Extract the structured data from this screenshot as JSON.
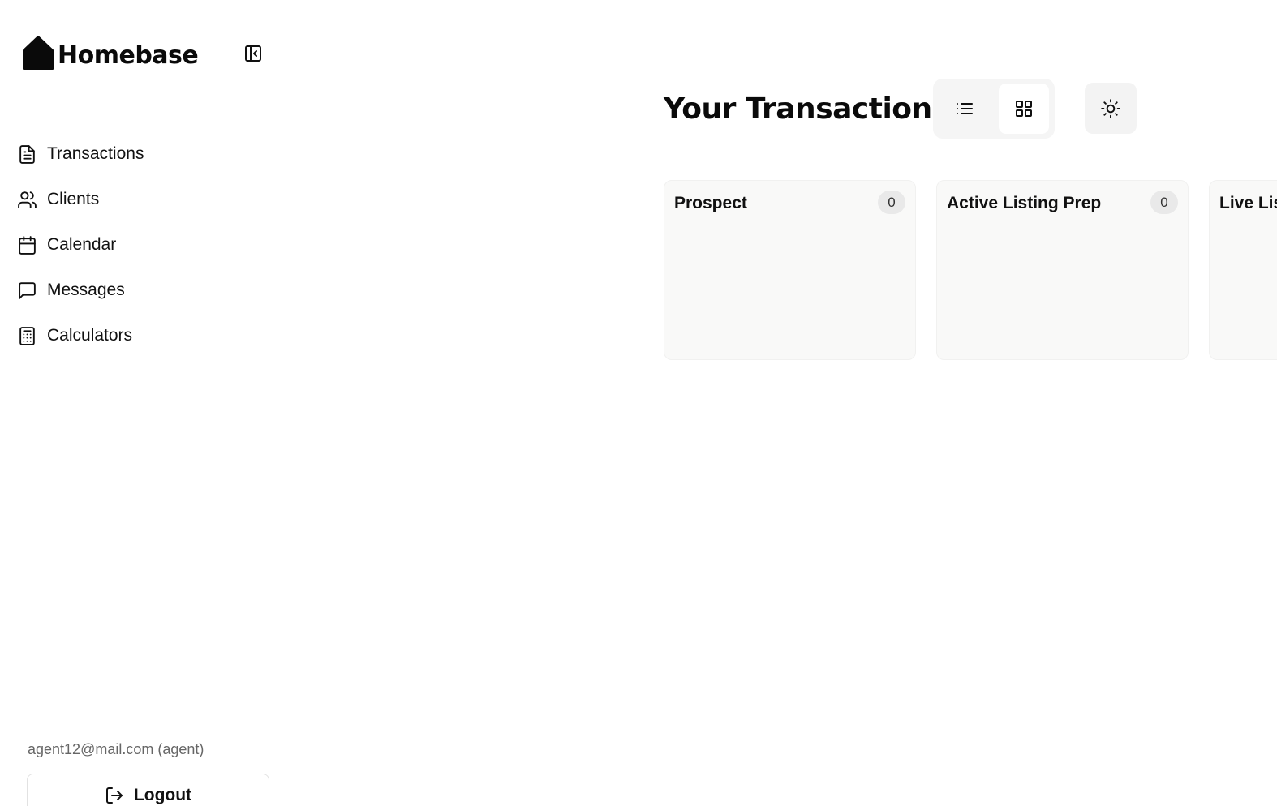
{
  "sidebar": {
    "brand": "Homebase",
    "nav": [
      {
        "label": "Transactions",
        "icon": "document-icon"
      },
      {
        "label": "Clients",
        "icon": "users-icon"
      },
      {
        "label": "Calendar",
        "icon": "calendar-icon"
      },
      {
        "label": "Messages",
        "icon": "message-icon"
      },
      {
        "label": "Calculators",
        "icon": "calculator-icon"
      }
    ],
    "user_email": "agent12@mail.com (agent)",
    "logout_label": "Logout"
  },
  "main": {
    "title": "Your Transactions",
    "view_mode": "grid",
    "columns": [
      {
        "title": "Prospect",
        "count": "0"
      },
      {
        "title": "Active Listing Prep",
        "count": "0"
      },
      {
        "title": "Live Lis"
      }
    ]
  },
  "colors": {
    "accent": "#111111",
    "column_bg": "#f9f9f8",
    "badge_bg": "#e9e9e9",
    "muted_text": "#666666"
  }
}
